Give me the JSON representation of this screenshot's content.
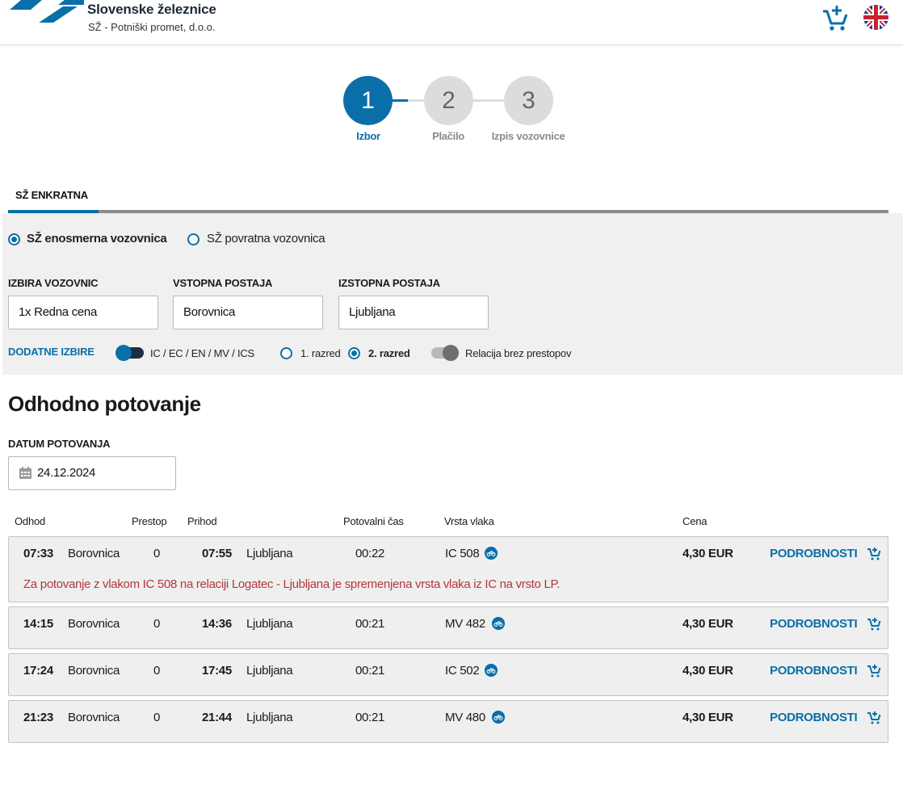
{
  "header": {
    "brand_name": "Slovenske železnice",
    "brand_sub": "SŽ - Potniški promet, d.o.o.",
    "icons": [
      "logo",
      "add-to-cart-icon",
      "uk-flag-icon"
    ]
  },
  "stepper": {
    "steps": [
      {
        "number": "1",
        "label": "Izbor",
        "active": true
      },
      {
        "number": "2",
        "label": "Plačilo",
        "active": false
      },
      {
        "number": "3",
        "label": "Izpis vozovnice",
        "active": false
      }
    ]
  },
  "tab": {
    "label": "SŽ ENKRATNA"
  },
  "ticket_type": {
    "one_way": "SŽ enosmerna vozovnica",
    "return": "SŽ povratna vozovnica",
    "selected": "one_way"
  },
  "fields": {
    "tickets_label": "IZBIRA VOZOVNIC",
    "tickets_value": "1x Redna cena",
    "from_label": "VSTOPNA POSTAJA",
    "from_value": "Borovnica",
    "to_label": "IZSTOPNA POSTAJA",
    "to_value": "Ljubljana"
  },
  "extras": {
    "label": "DODATNE IZBIRE",
    "train_types_label": "IC / EC / EN / MV / ICS",
    "train_types_on": true,
    "class1": "1. razred",
    "class2": "2. razred",
    "selected_class": "2",
    "direct_label": "Relacija brez prestopov",
    "direct_on": false
  },
  "journey": {
    "title": "Odhodno potovanje",
    "date_label": "DATUM POTOVANJA",
    "date_value": "24.12.2024"
  },
  "columns": {
    "departure": "Odhod",
    "transfers": "Prestop",
    "arrival": "Prihod",
    "duration": "Potovalni čas",
    "train": "Vrsta vlaka",
    "price": "Cena"
  },
  "rows": [
    {
      "dep_time": "07:33",
      "dep_station": "Borovnica",
      "transfers": "0",
      "arr_time": "07:55",
      "arr_station": "Ljubljana",
      "duration": "00:22",
      "train": "IC 508",
      "price": "4,30 EUR",
      "details": "PODROBNOSTI",
      "notice": "Za potovanje z vlakom IC 508 na relaciji Logatec - Ljubljana je spremenjena vrsta vlaka iz IC na vrsto LP."
    },
    {
      "dep_time": "14:15",
      "dep_station": "Borovnica",
      "transfers": "0",
      "arr_time": "14:36",
      "arr_station": "Ljubljana",
      "duration": "00:21",
      "train": "MV 482",
      "price": "4,30 EUR",
      "details": "PODROBNOSTI"
    },
    {
      "dep_time": "17:24",
      "dep_station": "Borovnica",
      "transfers": "0",
      "arr_time": "17:45",
      "arr_station": "Ljubljana",
      "duration": "00:21",
      "train": "IC 502",
      "price": "4,30 EUR",
      "details": "PODROBNOSTI"
    },
    {
      "dep_time": "21:23",
      "dep_station": "Borovnica",
      "transfers": "0",
      "arr_time": "21:44",
      "arr_station": "Ljubljana",
      "duration": "00:21",
      "train": "MV 480",
      "price": "4,30 EUR",
      "details": "PODROBNOSTI"
    }
  ],
  "colors": {
    "accent": "#0a6fa8",
    "notice": "#b3363a",
    "panel": "#f0f0f0"
  }
}
